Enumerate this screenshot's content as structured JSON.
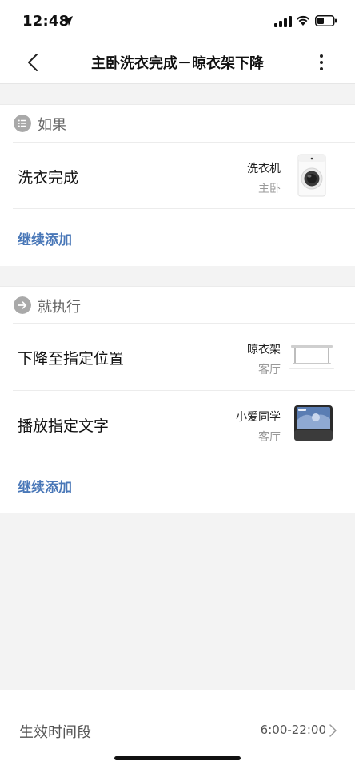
{
  "status_bar": {
    "time": "12:48"
  },
  "nav": {
    "title": "主卧洗衣完成－晾衣架下降"
  },
  "if_section": {
    "label": "如果",
    "items": [
      {
        "title": "洗衣完成",
        "device": "洗衣机",
        "room": "主卧",
        "icon": "washing-machine"
      }
    ],
    "add_label": "继续添加"
  },
  "then_section": {
    "label": "就执行",
    "items": [
      {
        "title": "下降至指定位置",
        "device": "晾衣架",
        "room": "客厅",
        "icon": "clothes-rack"
      },
      {
        "title": "播放指定文字",
        "device": "小爱同学",
        "room": "客厅",
        "icon": "smart-display"
      }
    ],
    "add_label": "继续添加"
  },
  "effective_period": {
    "label": "生效时间段",
    "value": "6:00-22:00"
  },
  "colors": {
    "accent": "#4a78b8",
    "background": "#f3f3f3",
    "section_icon": "#a9a9a9"
  }
}
